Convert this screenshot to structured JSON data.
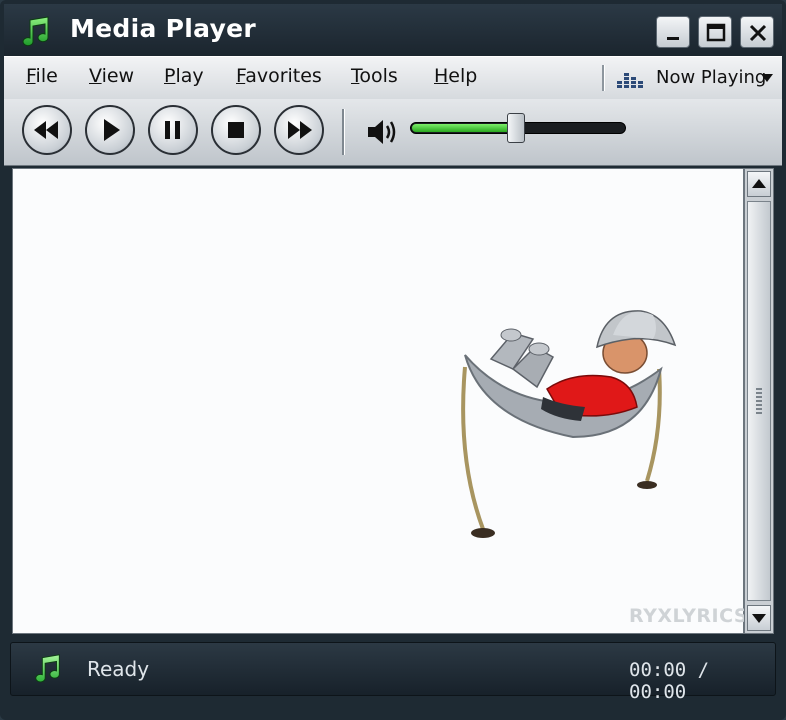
{
  "window": {
    "title": "Media Player",
    "icon": "music-note-icon"
  },
  "menu": {
    "items": [
      {
        "label": "File",
        "underline": "F",
        "rest": "ile"
      },
      {
        "label": "View",
        "underline": "V",
        "rest": "iew"
      },
      {
        "label": "Play",
        "underline": "P",
        "rest": "lay"
      },
      {
        "label": "Favorites",
        "underline": "F",
        "rest": "avorites"
      },
      {
        "label": "Tools",
        "underline": "T",
        "rest": "ools"
      },
      {
        "label": "Help",
        "underline": "H",
        "rest": "elp"
      }
    ],
    "now_playing": "Now Playing"
  },
  "controls": {
    "buttons": [
      "rewind",
      "play",
      "pause",
      "stop",
      "fast-forward"
    ],
    "volume_fraction": 0.49
  },
  "video": {
    "watermark": "RYXLYRICS"
  },
  "status": {
    "text": "Ready",
    "elapsed": "00:00",
    "separator": "/",
    "total": "00:00"
  },
  "colors": {
    "accent_green": "#35c22a",
    "title_bg": "#1b252e"
  }
}
